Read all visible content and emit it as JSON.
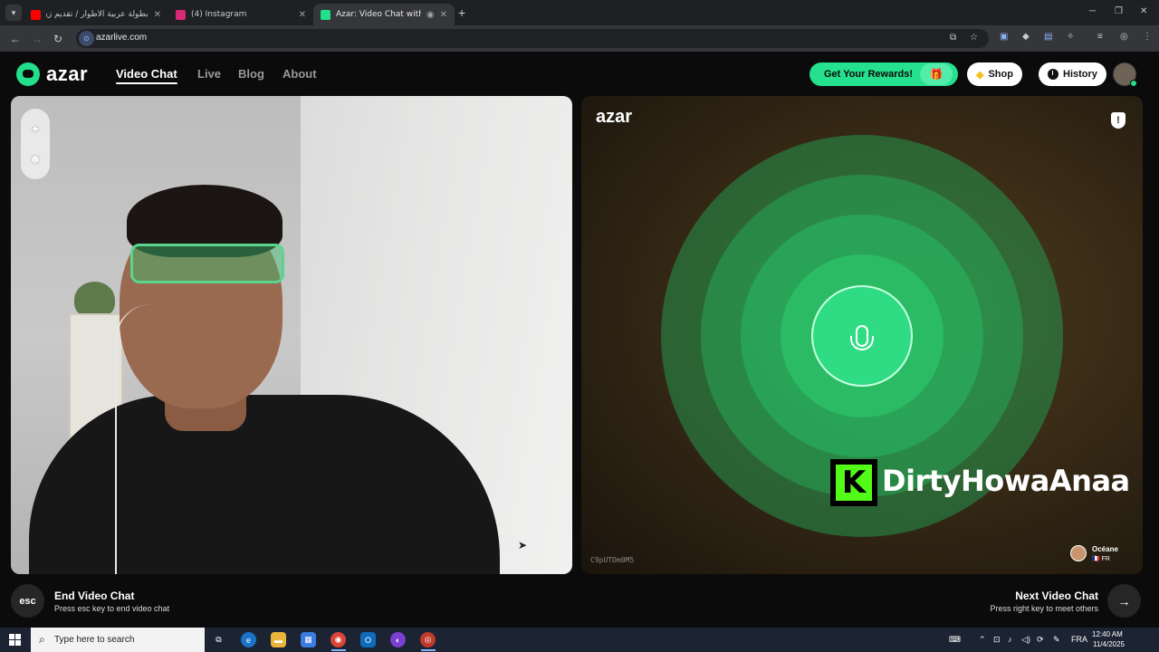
{
  "browser": {
    "tabs": [
      {
        "label": "بطولة عربية الأطوار / تقديم زيادة",
        "favicon_color": "#ff0000",
        "active": false
      },
      {
        "label": "(4) Instagram",
        "favicon_color": "#d62976",
        "active": false
      },
      {
        "label": "Azar: Video Chat with New",
        "favicon_color": "#22e08a",
        "active": true
      }
    ],
    "url": "azarlive.com"
  },
  "site": {
    "logo": "azar",
    "nav": [
      {
        "label": "Video Chat",
        "active": true
      },
      {
        "label": "Live",
        "active": false
      },
      {
        "label": "Blog",
        "active": false
      },
      {
        "label": "About",
        "active": false
      }
    ],
    "rewards_label": "Get Your Rewards!",
    "shop_label": "Shop",
    "history_label": "History",
    "accent_color": "#22e08a"
  },
  "remote_video": {
    "watermark": "azar",
    "room_id": "C9pUTDm0M5",
    "overlay_text": "DirtyHowaAnaa",
    "peer_name": "Océane",
    "peer_country": "🇫🇷 FR"
  },
  "controls": {
    "end_key": "esc",
    "end_title": "End Video Chat",
    "end_subtitle": "Press esc key to end video chat",
    "next_title": "Next Video Chat",
    "next_subtitle": "Press right key to meet others"
  },
  "taskbar": {
    "search_placeholder": "Type here to search",
    "language": "FRA",
    "time": "12:40 AM",
    "date": "11/4/2025"
  }
}
